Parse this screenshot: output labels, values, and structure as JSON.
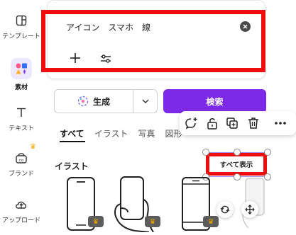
{
  "sidebar": {
    "items": [
      {
        "label": "テンプレート",
        "icon": "template-icon"
      },
      {
        "label": "素材",
        "icon": "elements-icon",
        "active": true
      },
      {
        "label": "テキスト",
        "icon": "text-icon"
      },
      {
        "label": "ブランド",
        "icon": "brand-icon"
      },
      {
        "label": "アップロード",
        "icon": "upload-icon"
      }
    ]
  },
  "search": {
    "query": "アイコン　スマホ　線"
  },
  "buttons": {
    "generate": "生成",
    "search": "検索"
  },
  "tabs": [
    {
      "label": "すべて",
      "active": true
    },
    {
      "label": "イラスト"
    },
    {
      "label": "写真"
    },
    {
      "label": "図形"
    }
  ],
  "section": {
    "title": "イラスト",
    "show_all": "すべて表示"
  },
  "colors": {
    "accent": "#7d2ae8",
    "highlight": "#ee0e0e",
    "active_bg": "#ede7ff"
  }
}
